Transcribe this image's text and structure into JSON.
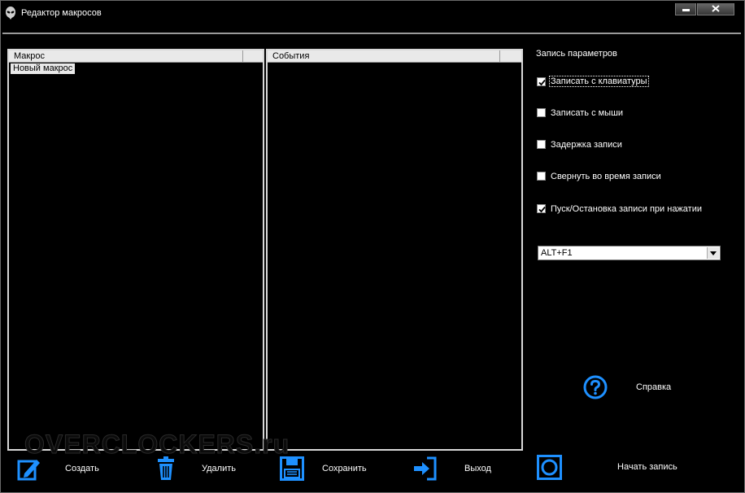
{
  "window": {
    "title": "Редактор макросов",
    "accent_color": "#1e90ff"
  },
  "macro_panel": {
    "header": "Макрос",
    "items": [
      "Новый макрос"
    ]
  },
  "events_panel": {
    "header": "События"
  },
  "options": {
    "title": "Запись параметров",
    "checkboxes": [
      {
        "label": "Записать с клавиатуры",
        "checked": true
      },
      {
        "label": "Записать с мыши",
        "checked": false
      },
      {
        "label": "Задержка записи",
        "checked": false
      },
      {
        "label": "Свернуть во время записи",
        "checked": false
      },
      {
        "label": "Пуск/Остановка записи при нажатии",
        "checked": true
      }
    ],
    "hotkey": "ALT+F1"
  },
  "help": {
    "label": "Справка"
  },
  "toolbar": {
    "create": "Создать",
    "delete": "Удалить",
    "save": "Сохранить",
    "exit": "Выход",
    "record": "Начать запись"
  },
  "watermark": "OVERCLOCKERS.ru"
}
